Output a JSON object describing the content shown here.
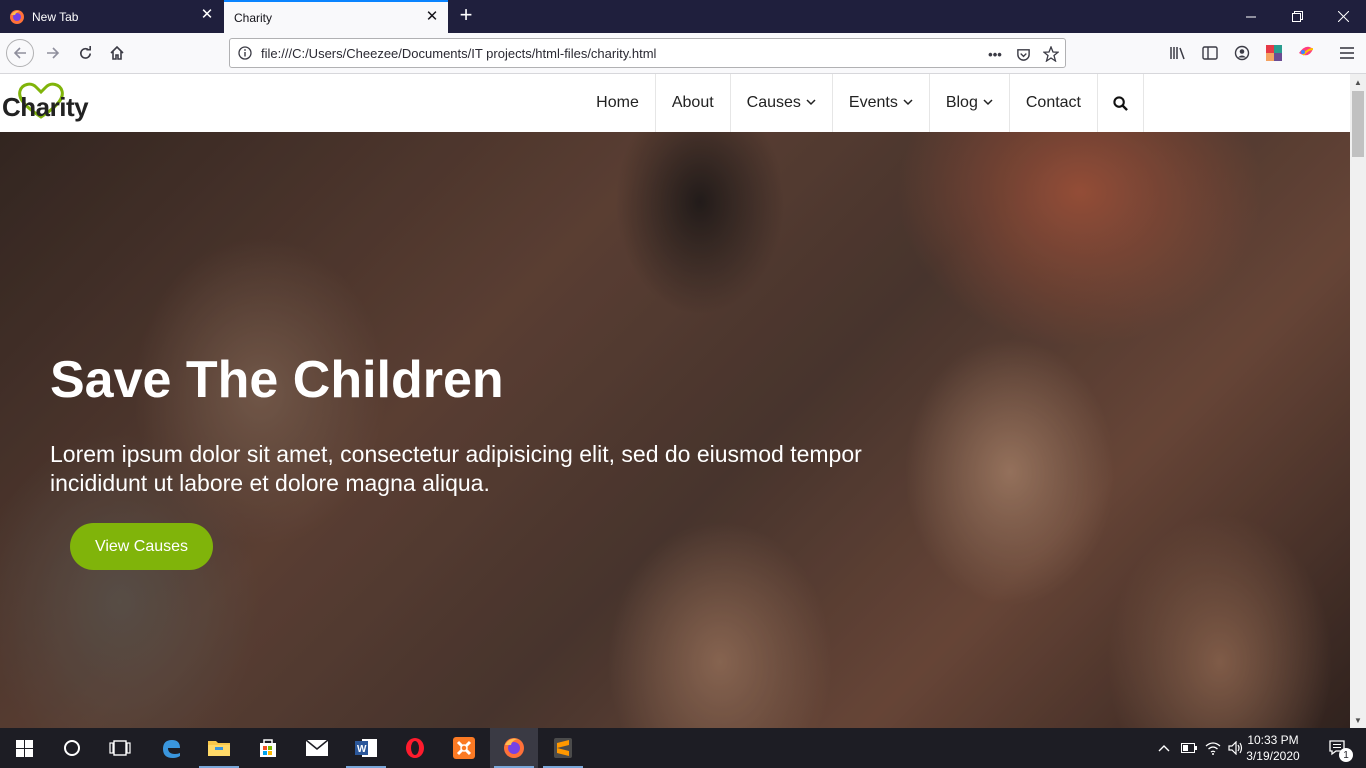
{
  "browser": {
    "tabs": [
      {
        "label": "New Tab",
        "active": false
      },
      {
        "label": "Charity",
        "active": true
      }
    ],
    "url": "file:///C:/Users/Cheezee/Documents/IT projects/html-files/charity.html"
  },
  "site": {
    "logo_text": "Charity",
    "menu": [
      {
        "label": "Home",
        "dropdown": false
      },
      {
        "label": "About",
        "dropdown": false
      },
      {
        "label": "Causes",
        "dropdown": true
      },
      {
        "label": "Events",
        "dropdown": true
      },
      {
        "label": "Blog",
        "dropdown": true
      },
      {
        "label": "Contact",
        "dropdown": false
      }
    ],
    "accent_color": "#80b40a",
    "hero": {
      "title": "Save The Children",
      "text": "Lorem ipsum dolor sit amet, consectetur adipisicing elit, sed do eiusmod tempor incididunt ut labore et dolore magna aliqua.",
      "button_label": "View Causes"
    }
  },
  "taskbar": {
    "clock_time": "10:33 PM",
    "clock_date": "3/19/2020",
    "notification_count": "1",
    "apps": [
      "start-icon",
      "cortana-icon",
      "task-view-icon",
      "edge-icon",
      "file-explorer-icon",
      "store-icon",
      "mail-icon",
      "word-icon",
      "opera-icon",
      "xampp-icon",
      "firefox-icon",
      "sublime-icon"
    ]
  }
}
